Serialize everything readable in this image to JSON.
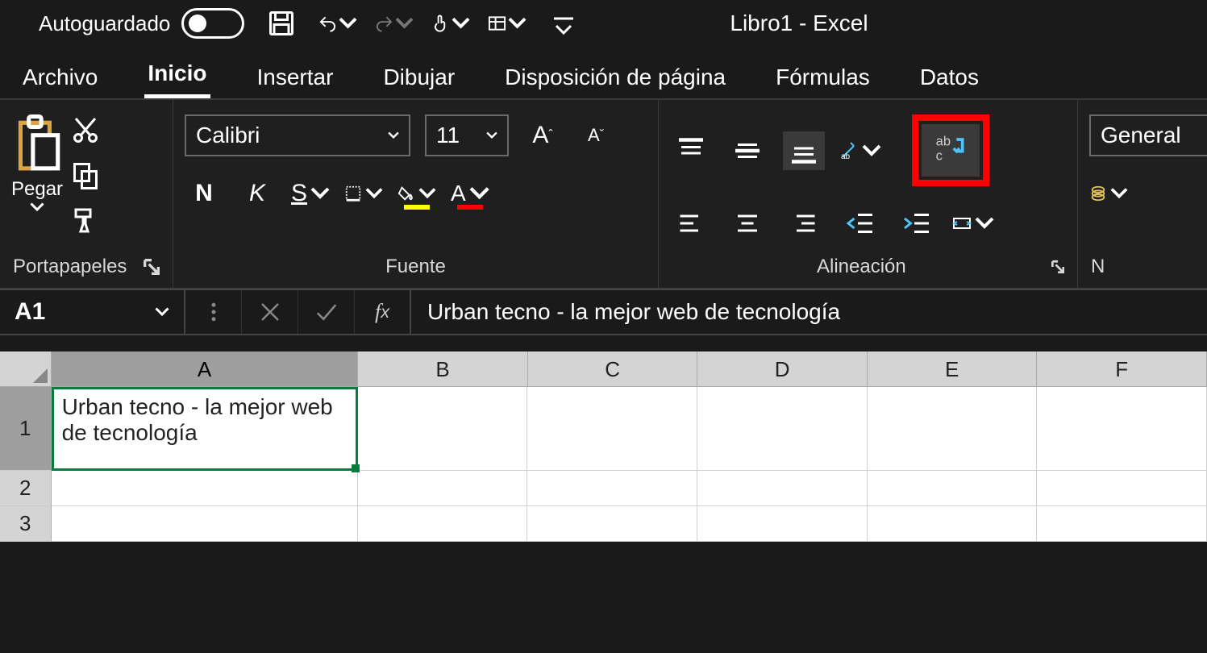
{
  "qat": {
    "autosave_label": "Autoguardado",
    "autosave_on": false
  },
  "title": "Libro1 - Excel",
  "tabs": [
    "Archivo",
    "Inicio",
    "Insertar",
    "Dibujar",
    "Disposición de página",
    "Fórmulas",
    "Datos"
  ],
  "active_tab": 1,
  "groups": {
    "clipboard": {
      "label": "Portapapeles",
      "paste": "Pegar"
    },
    "font": {
      "label": "Fuente",
      "name": "Calibri",
      "size": "11"
    },
    "alignment": {
      "label": "Alineación"
    },
    "number": {
      "label": "N",
      "format": "General"
    }
  },
  "formula_bar": {
    "cell_ref": "A1",
    "content": "Urban tecno - la mejor web de tecnología"
  },
  "grid": {
    "columns": [
      "A",
      "B",
      "C",
      "D",
      "E",
      "F"
    ],
    "rows": [
      "1",
      "2",
      "3"
    ],
    "selected": "A1",
    "cells": {
      "A1": "Urban tecno - la mejor web de tecnología"
    }
  }
}
